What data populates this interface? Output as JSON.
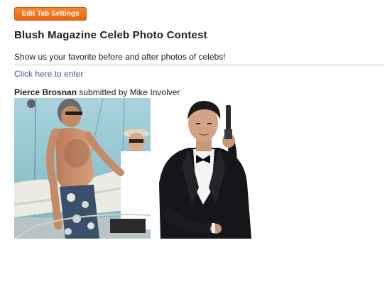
{
  "toolbar": {
    "edit_tab_label": "Edit Tab Settings"
  },
  "contest": {
    "title": "Blush Magazine Celeb Photo Contest",
    "description": "Show us your favorite before and after photos of celebs!",
    "enter_link": "Click here to enter"
  },
  "entry": {
    "celebrity": "Pierce Brosnan",
    "submitted_by": " submitted by Mike Involver"
  },
  "photos": [
    {
      "icon": "before-photo-beach-boat"
    },
    {
      "icon": "after-photo-tuxedo-portrait"
    }
  ]
}
